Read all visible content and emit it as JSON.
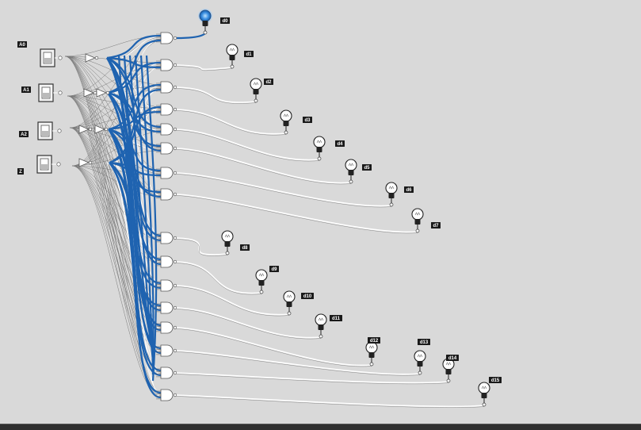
{
  "inputs": [
    {
      "label": "A0"
    },
    {
      "label": "A1"
    },
    {
      "label": "A2"
    },
    {
      "label": "Z"
    }
  ],
  "outputs": [
    {
      "label": "d0",
      "on": true
    },
    {
      "label": "d1",
      "on": false
    },
    {
      "label": "d2",
      "on": false
    },
    {
      "label": "d3",
      "on": false
    },
    {
      "label": "d4",
      "on": false
    },
    {
      "label": "d5",
      "on": false
    },
    {
      "label": "d6",
      "on": false
    },
    {
      "label": "d7",
      "on": false
    },
    {
      "label": "d8",
      "on": false
    },
    {
      "label": "d9",
      "on": false
    },
    {
      "label": "d10",
      "on": false
    },
    {
      "label": "d11",
      "on": false
    },
    {
      "label": "d12",
      "on": false
    },
    {
      "label": "d13",
      "on": false
    },
    {
      "label": "d14",
      "on": false
    },
    {
      "label": "d15",
      "on": false
    }
  ],
  "colors": {
    "background": "#d9d9d9",
    "active_wire": "#1f63b0",
    "inactive_wire": "#ffffff",
    "lamp_on": "#2a7fd4",
    "label_bg": "#1a1a1a"
  }
}
